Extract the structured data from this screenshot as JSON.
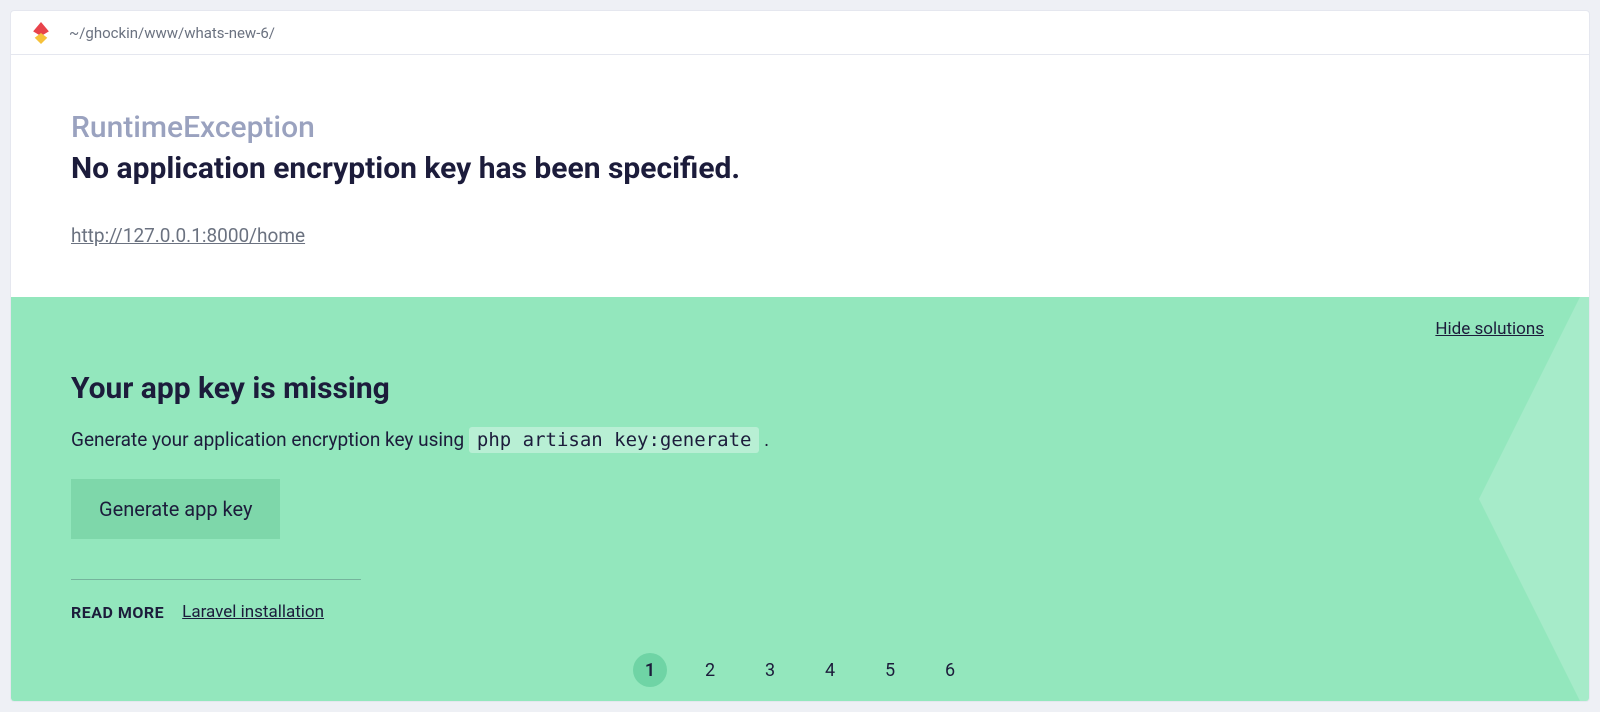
{
  "topbar": {
    "path": "~/ghockin/www/whats-new-6/"
  },
  "exception": {
    "type": "RuntimeException",
    "message": "No application encryption key has been specified.",
    "url_text": "http://127.0.0.1:8000/home",
    "url_href": "http://127.0.0.1:8000/home"
  },
  "solution": {
    "hide_label": "Hide solutions",
    "title": "Your app key is missing",
    "desc_prefix": "Generate your application encryption key using ",
    "desc_code": "php artisan key:generate",
    "desc_suffix": " .",
    "button_label": "Generate app key",
    "readmore_label": "READ MORE",
    "readmore_link_text": "Laravel installation"
  },
  "pager": {
    "items": [
      "1",
      "2",
      "3",
      "4",
      "5",
      "6"
    ],
    "active_index": 0
  }
}
